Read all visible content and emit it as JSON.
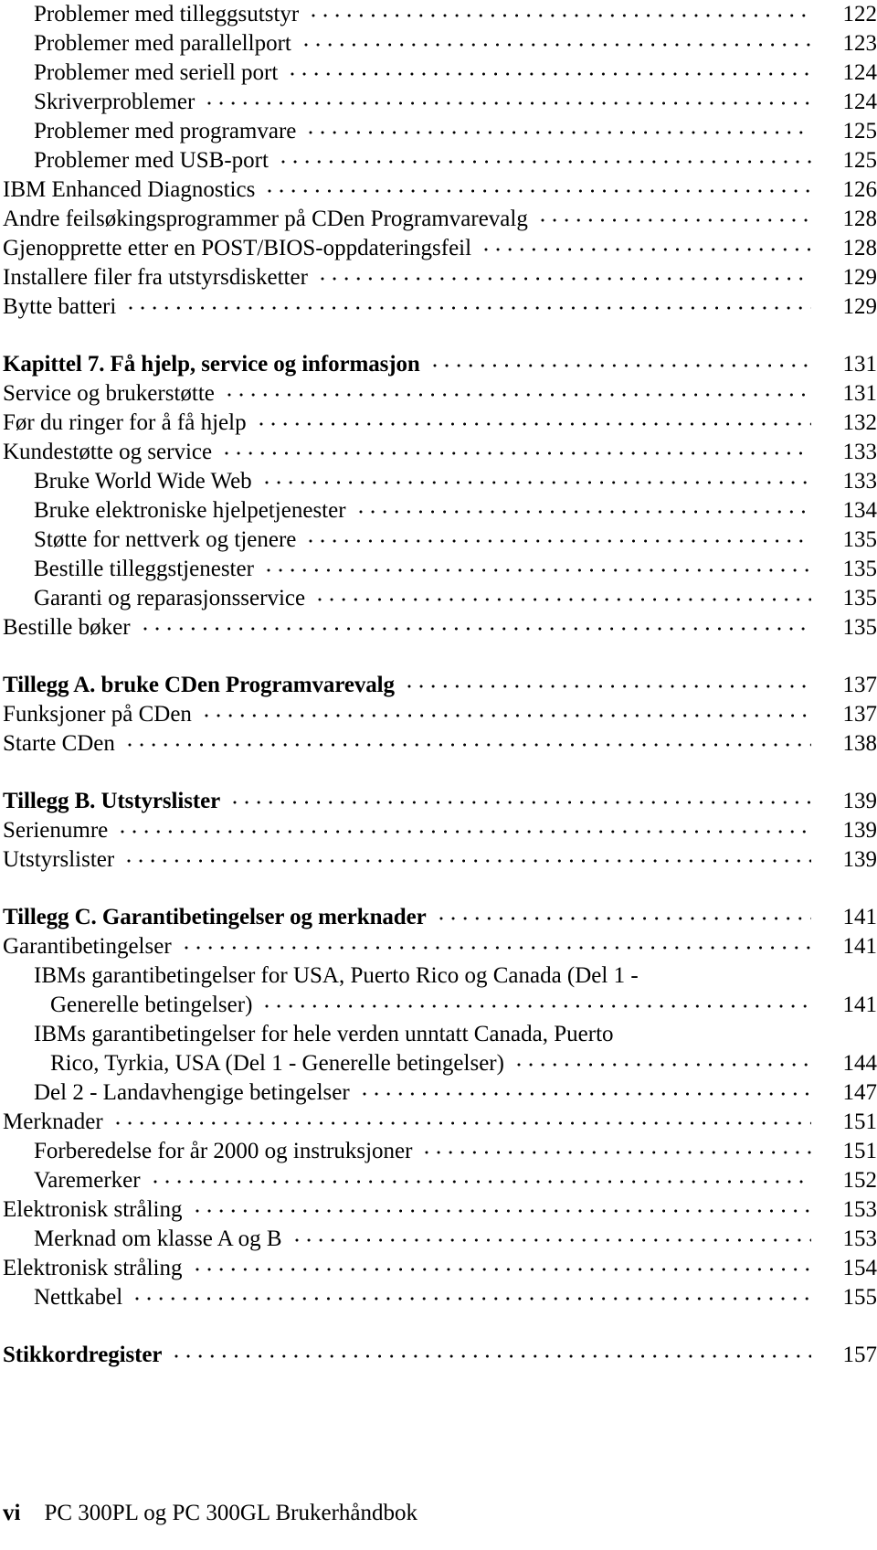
{
  "page": {
    "folio": "vi",
    "book_title": "PC 300PL og PC 300GL Brukerhåndbok"
  },
  "toc": {
    "entries": [
      {
        "label": "Problemer med tilleggsutstyr",
        "page": "122",
        "level": 1,
        "bold": false,
        "gap_before": false,
        "wrap_first": false
      },
      {
        "label": "Problemer med parallellport",
        "page": "123",
        "level": 1,
        "bold": false,
        "gap_before": false,
        "wrap_first": false
      },
      {
        "label": "Problemer med seriell port",
        "page": "124",
        "level": 1,
        "bold": false,
        "gap_before": false,
        "wrap_first": false
      },
      {
        "label": "Skriverproblemer",
        "page": "124",
        "level": 1,
        "bold": false,
        "gap_before": false,
        "wrap_first": false
      },
      {
        "label": "Problemer med programvare",
        "page": "125",
        "level": 1,
        "bold": false,
        "gap_before": false,
        "wrap_first": false
      },
      {
        "label": "Problemer med USB-port",
        "page": "125",
        "level": 1,
        "bold": false,
        "gap_before": false,
        "wrap_first": false
      },
      {
        "label": "IBM Enhanced Diagnostics",
        "page": "126",
        "level": 0,
        "bold": false,
        "gap_before": false,
        "wrap_first": false
      },
      {
        "label": "Andre feilsøkingsprogrammer på CDen Programvarevalg",
        "page": "128",
        "level": 0,
        "bold": false,
        "gap_before": false,
        "wrap_first": false
      },
      {
        "label": "Gjenopprette etter en POST/BIOS-oppdateringsfeil",
        "page": "128",
        "level": 0,
        "bold": false,
        "gap_before": false,
        "wrap_first": false
      },
      {
        "label": "Installere filer fra utstyrsdisketter",
        "page": "129",
        "level": 0,
        "bold": false,
        "gap_before": false,
        "wrap_first": false
      },
      {
        "label": "Bytte batteri",
        "page": "129",
        "level": 0,
        "bold": false,
        "gap_before": false,
        "wrap_first": false
      },
      {
        "label": "Kapittel 7.  Få hjelp, service og informasjon",
        "page": "131",
        "level": 0,
        "bold": true,
        "gap_before": true,
        "wrap_first": false
      },
      {
        "label": "Service og brukerstøtte",
        "page": "131",
        "level": 0,
        "bold": false,
        "gap_before": false,
        "wrap_first": false
      },
      {
        "label": "Før du ringer for å få hjelp",
        "page": "132",
        "level": 0,
        "bold": false,
        "gap_before": false,
        "wrap_first": false
      },
      {
        "label": "Kundestøtte og service",
        "page": "133",
        "level": 0,
        "bold": false,
        "gap_before": false,
        "wrap_first": false
      },
      {
        "label": "Bruke World Wide Web",
        "page": "133",
        "level": 1,
        "bold": false,
        "gap_before": false,
        "wrap_first": false
      },
      {
        "label": "Bruke elektroniske hjelpetjenester",
        "page": "134",
        "level": 1,
        "bold": false,
        "gap_before": false,
        "wrap_first": false
      },
      {
        "label": "Støtte for nettverk og tjenere",
        "page": "135",
        "level": 1,
        "bold": false,
        "gap_before": false,
        "wrap_first": false
      },
      {
        "label": "Bestille tilleggstjenester",
        "page": "135",
        "level": 1,
        "bold": false,
        "gap_before": false,
        "wrap_first": false
      },
      {
        "label": "Garanti og reparasjonsservice",
        "page": "135",
        "level": 1,
        "bold": false,
        "gap_before": false,
        "wrap_first": false
      },
      {
        "label": "Bestille bøker",
        "page": "135",
        "level": 0,
        "bold": false,
        "gap_before": false,
        "wrap_first": false
      },
      {
        "label": "Tillegg A.  bruke CDen Programvarevalg",
        "page": "137",
        "level": 0,
        "bold": true,
        "gap_before": true,
        "wrap_first": false
      },
      {
        "label": "Funksjoner på CDen",
        "page": "137",
        "level": 0,
        "bold": false,
        "gap_before": false,
        "wrap_first": false
      },
      {
        "label": "Starte CDen",
        "page": "138",
        "level": 0,
        "bold": false,
        "gap_before": false,
        "wrap_first": false
      },
      {
        "label": "Tillegg B.  Utstyrslister",
        "page": "139",
        "level": 0,
        "bold": true,
        "gap_before": true,
        "wrap_first": false
      },
      {
        "label": "Serienumre",
        "page": "139",
        "level": 0,
        "bold": false,
        "gap_before": false,
        "wrap_first": false
      },
      {
        "label": "Utstyrslister",
        "page": "139",
        "level": 0,
        "bold": false,
        "gap_before": false,
        "wrap_first": false
      },
      {
        "label": "Tillegg C.  Garantibetingelser og merknader",
        "page": "141",
        "level": 0,
        "bold": true,
        "gap_before": true,
        "wrap_first": false
      },
      {
        "label": "Garantibetingelser",
        "page": "141",
        "level": 0,
        "bold": false,
        "gap_before": false,
        "wrap_first": false
      },
      {
        "label": "IBMs garantibetingelser for USA, Puerto Rico og Canada (Del 1 -",
        "page": "",
        "level": 1,
        "bold": false,
        "gap_before": false,
        "wrap_first": true
      },
      {
        "label": "Generelle betingelser)",
        "page": "141",
        "level": 2,
        "bold": false,
        "gap_before": false,
        "wrap_first": false
      },
      {
        "label": "IBMs garantibetingelser for hele verden unntatt Canada, Puerto",
        "page": "",
        "level": 1,
        "bold": false,
        "gap_before": false,
        "wrap_first": true
      },
      {
        "label": "Rico, Tyrkia, USA (Del 1 - Generelle betingelser)",
        "page": "144",
        "level": 2,
        "bold": false,
        "gap_before": false,
        "wrap_first": false
      },
      {
        "label": "Del 2 - Landavhengige betingelser",
        "page": "147",
        "level": 1,
        "bold": false,
        "gap_before": false,
        "wrap_first": false
      },
      {
        "label": "Merknader",
        "page": "151",
        "level": 0,
        "bold": false,
        "gap_before": false,
        "wrap_first": false
      },
      {
        "label": "Forberedelse for år 2000 og instruksjoner",
        "page": "151",
        "level": 1,
        "bold": false,
        "gap_before": false,
        "wrap_first": false
      },
      {
        "label": "Varemerker",
        "page": "152",
        "level": 1,
        "bold": false,
        "gap_before": false,
        "wrap_first": false
      },
      {
        "label": "Elektronisk stråling",
        "page": "153",
        "level": 0,
        "bold": false,
        "gap_before": false,
        "wrap_first": false
      },
      {
        "label": "Merknad om klasse A og B",
        "page": "153",
        "level": 1,
        "bold": false,
        "gap_before": false,
        "wrap_first": false
      },
      {
        "label": "Elektronisk stråling",
        "page": "154",
        "level": 0,
        "bold": false,
        "gap_before": false,
        "wrap_first": false
      },
      {
        "label": "Nettkabel",
        "page": "155",
        "level": 1,
        "bold": false,
        "gap_before": false,
        "wrap_first": false
      },
      {
        "label": "Stikkordregister",
        "page": "157",
        "level": 0,
        "bold": true,
        "gap_before": true,
        "wrap_first": false
      }
    ]
  }
}
